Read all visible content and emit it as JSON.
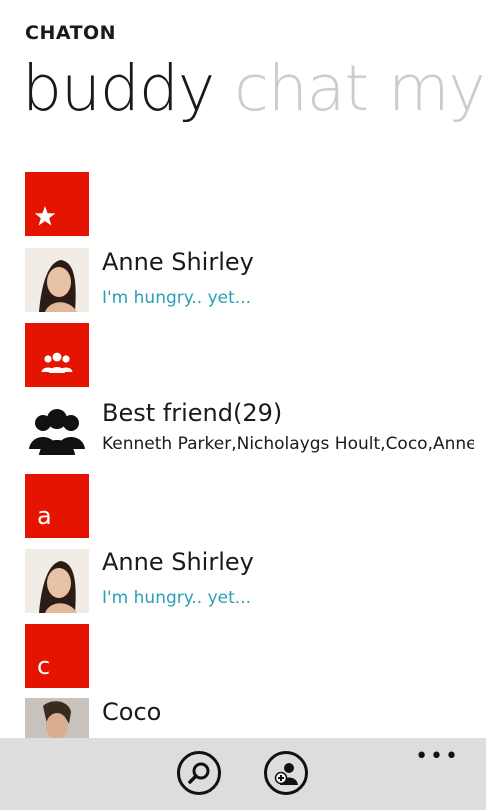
{
  "app": {
    "title": "CHATON"
  },
  "pivot": {
    "items": [
      "buddy",
      "chat",
      "my"
    ]
  },
  "sections": {
    "favorites": {
      "icon": "star-icon"
    },
    "groups": {
      "icon": "group-icon"
    },
    "a": {
      "letter": "a"
    },
    "c": {
      "letter": "c"
    }
  },
  "contacts": {
    "fav_anne": {
      "name": "Anne Shirley",
      "status": "I'm hungry.. yet..."
    },
    "group_best": {
      "name": "Best friend(29)",
      "members": "Kenneth Parker,Nicholaygs Hoult,Coco,Anne Shirley"
    },
    "a_anne": {
      "name": "Anne Shirley",
      "status": "I'm hungry.. yet..."
    },
    "c_coco": {
      "name": "Coco"
    }
  },
  "appbar": {
    "buttons": [
      "search-icon",
      "add-buddy-icon"
    ],
    "more": "•••"
  },
  "colors": {
    "accent": "#e51400",
    "status": "#2a9fb6",
    "appbar": "#dddddd"
  }
}
